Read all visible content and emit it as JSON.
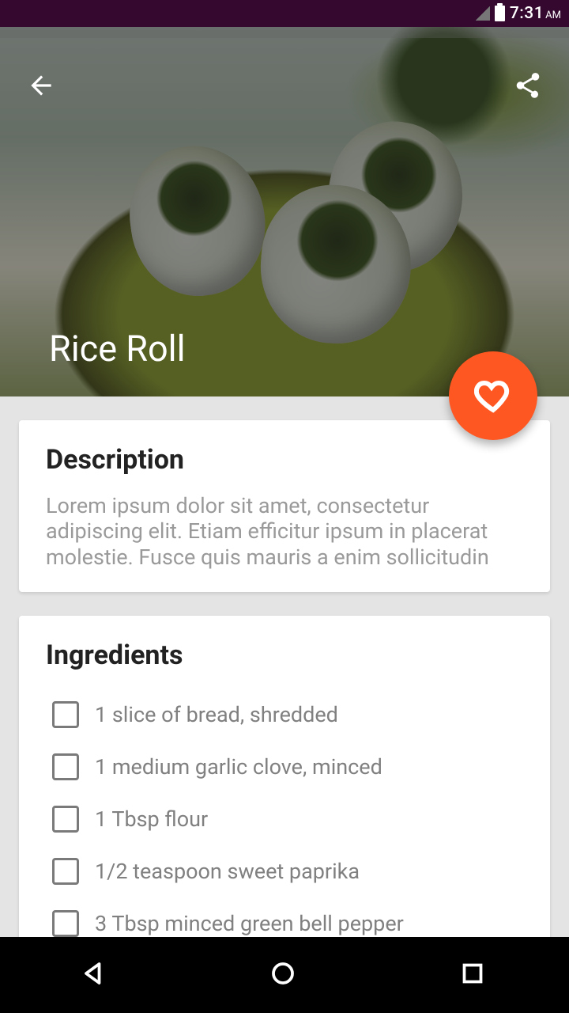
{
  "status": {
    "time": "7:31",
    "ampm": "AM"
  },
  "hero": {
    "title": "Rice Roll"
  },
  "description": {
    "heading": "Description",
    "body": "Lorem ipsum dolor sit amet, consectetur adipiscing elit. Etiam efficitur ipsum in placerat molestie. Fusce quis mauris a enim sollicitudin"
  },
  "ingredients": {
    "heading": "Ingredients",
    "items": [
      "1 slice of bread, shredded",
      "1 medium garlic clove, minced",
      "1 Tbsp flour",
      "1/2 teaspoon sweet paprika",
      "3 Tbsp minced green bell pepper"
    ]
  }
}
